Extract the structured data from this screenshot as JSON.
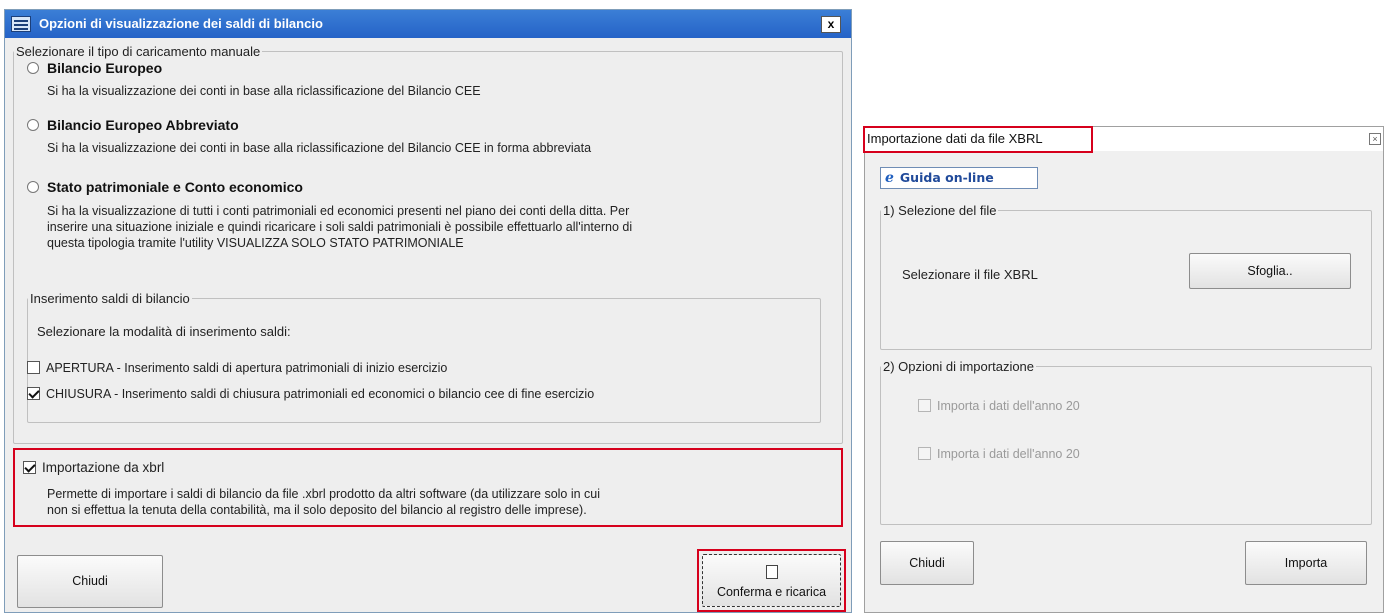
{
  "dialog1": {
    "title": "Opzioni di visualizzazione dei saldi di bilancio",
    "close": "x",
    "group_label": "Selezionare il tipo di caricamento manuale",
    "options": [
      {
        "label": "Bilancio Europeo",
        "desc": "Si ha la visualizzazione dei conti in base alla riclassificazione del Bilancio CEE"
      },
      {
        "label": "Bilancio Europeo Abbreviato",
        "desc": "Si ha la visualizzazione dei conti in base alla riclassificazione del Bilancio CEE in forma abbreviata"
      },
      {
        "label": "Stato patrimoniale e Conto economico",
        "desc_lines": [
          "Si ha la visualizzazione di tutti i conti patrimoniali ed economici presenti nel piano dei conti della ditta. Per",
          "inserire una situazione iniziale e quindi ricaricare i soli saldi patrimoniali è possibile effettuarlo all'interno di",
          "questa tipologia tramite l'utility VISUALIZZA SOLO STATO PATRIMONIALE"
        ]
      }
    ],
    "saldi_group_label": "Inserimento saldi di bilancio",
    "saldi_prompt": "Selezionare la modalità di inserimento saldi:",
    "apertura": {
      "label": "APERTURA  - Inserimento saldi di apertura patrimoniali di inizio esercizio",
      "checked": false
    },
    "chiusura": {
      "label": "CHIUSURA  -  Inserimento saldi di chiusura patrimoniali ed economici o bilancio cee di fine esercizio",
      "checked": true
    },
    "xbrl": {
      "label": "Importazione da xbrl",
      "checked": true,
      "desc_lines": [
        "Permette di importare i saldi di bilancio da file .xbrl prodotto da altri software (da utilizzare solo in cui",
        "non si effettua la tenuta della contabilità, ma il solo deposito del bilancio al registro delle imprese)."
      ]
    },
    "buttons": {
      "close": "Chiudi",
      "confirm": "Conferma e ricarica"
    }
  },
  "dialog2": {
    "title": "Importazione dati da file XBRL",
    "help_button": "Guida on-line",
    "file_group": {
      "label": "1) Selezione del file",
      "prompt": "Selezionare il file XBRL",
      "browse": "Sfoglia.."
    },
    "import_group": {
      "label": "2) Opzioni di importazione",
      "options": [
        "Importa i dati dell'anno 20",
        "Importa i dati dell'anno 20"
      ]
    },
    "buttons": {
      "close": "Chiudi",
      "import": "Importa"
    }
  },
  "colors": {
    "title_bar": "#2563c7",
    "highlight": "#d6001c",
    "dialog_bg": "#eeeeee"
  }
}
